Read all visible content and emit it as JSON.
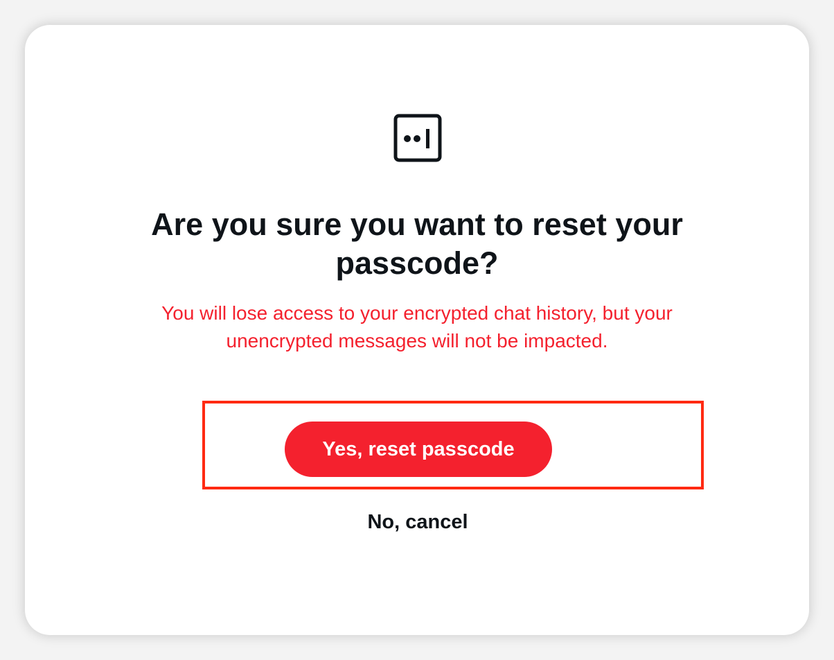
{
  "dialog": {
    "icon": "passcode-icon",
    "title_lines": [
      "Are you sure you want to reset your",
      "passcode?"
    ],
    "warning_lines": [
      "You will lose access to your encrypted chat history, but your",
      "unencrypted messages will not be impacted."
    ],
    "confirm_label": "Yes, reset passcode",
    "cancel_label": "No, cancel"
  },
  "colors": {
    "danger": "#f4212e",
    "text": "#0f1419",
    "highlight": "#ff2a12",
    "background": "#ffffff"
  }
}
